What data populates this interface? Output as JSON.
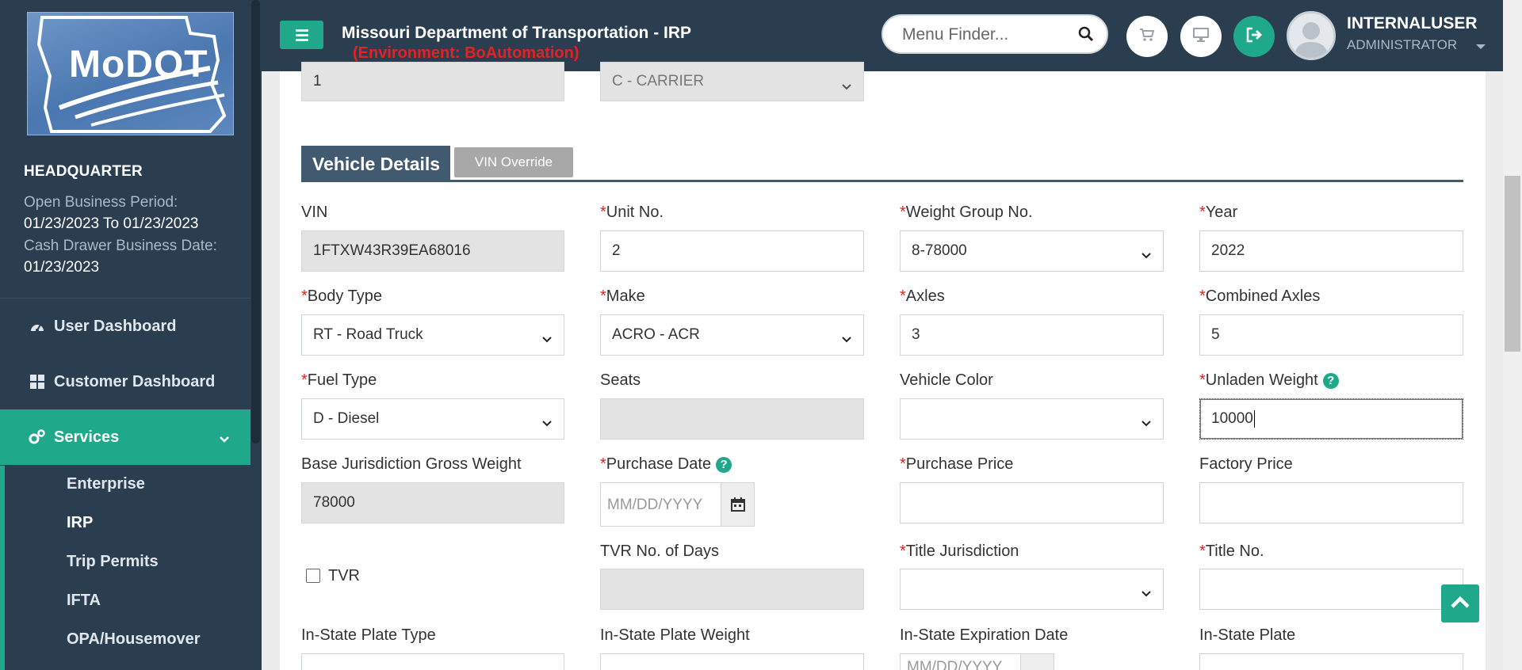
{
  "sidebar": {
    "logo_text": "MoDOT",
    "org": "HEADQUARTER",
    "open_period_label": "Open Business Period:",
    "open_period_value": "01/23/2023 To 01/23/2023",
    "cash_drawer_label": "Cash Drawer Business Date:",
    "cash_drawer_value": "01/23/2023",
    "nav": [
      {
        "label": "User Dashboard",
        "icon": "speedometer-icon"
      },
      {
        "label": "Customer Dashboard",
        "icon": "grid-icon"
      },
      {
        "label": "Services",
        "icon": "gears-icon"
      }
    ],
    "sub_items": [
      "Enterprise",
      "IRP",
      "Trip Permits",
      "IFTA",
      "OPA/Housemover"
    ],
    "accent": "#1fa98a"
  },
  "header": {
    "title": "Missouri Department of Transportation - IRP",
    "environment": "(Environment: BoAutomation)",
    "menu_finder_placeholder": "Menu Finder...",
    "username": "INTERNALUSER",
    "role": "ADMINISTRATOR",
    "icons": [
      "cart-icon",
      "monitor-icon",
      "logout-icon"
    ]
  },
  "top_row": {
    "field1_value": "1",
    "field2_value": "C - CARRIER"
  },
  "section": {
    "title": "Vehicle Details",
    "vin_override_label": "VIN Override"
  },
  "fields": {
    "vin": {
      "label": "VIN",
      "value": "1FTXW43R39EA68016"
    },
    "unit_no": {
      "label": "Unit No.",
      "value": "2"
    },
    "weight_group": {
      "label": "Weight Group No.",
      "value": "8-78000"
    },
    "year": {
      "label": "Year",
      "value": "2022"
    },
    "body_type": {
      "label": "Body Type",
      "value": "RT - Road Truck"
    },
    "make": {
      "label": "Make",
      "value": "ACRO - ACR"
    },
    "axles": {
      "label": "Axles",
      "value": "3"
    },
    "combined_axles": {
      "label": "Combined Axles",
      "value": "5"
    },
    "fuel_type": {
      "label": "Fuel Type",
      "value": "D - Diesel"
    },
    "seats": {
      "label": "Seats",
      "value": ""
    },
    "vehicle_color": {
      "label": "Vehicle Color",
      "value": ""
    },
    "unladen_weight": {
      "label": "Unladen Weight",
      "value": "10000"
    },
    "base_gross_weight": {
      "label": "Base Jurisdiction Gross Weight",
      "value": "78000"
    },
    "purchase_date": {
      "label": "Purchase Date",
      "placeholder": "MM/DD/YYYY"
    },
    "purchase_price": {
      "label": "Purchase Price",
      "value": ""
    },
    "factory_price": {
      "label": "Factory Price",
      "value": ""
    },
    "tvr": {
      "label": "TVR"
    },
    "tvr_days": {
      "label": "TVR No. of Days",
      "value": ""
    },
    "title_jurisdiction": {
      "label": "Title Jurisdiction",
      "value": ""
    },
    "title_no": {
      "label": "Title No.",
      "value": ""
    },
    "instate_plate_type": {
      "label": "In-State Plate Type"
    },
    "instate_plate_weight": {
      "label": "In-State Plate Weight"
    },
    "instate_expiration": {
      "label": "In-State Expiration Date",
      "placeholder": "MM/DD/YYYY"
    },
    "instate_plate": {
      "label": "In-State Plate"
    }
  },
  "required_marker": "*",
  "help_mark": "?"
}
